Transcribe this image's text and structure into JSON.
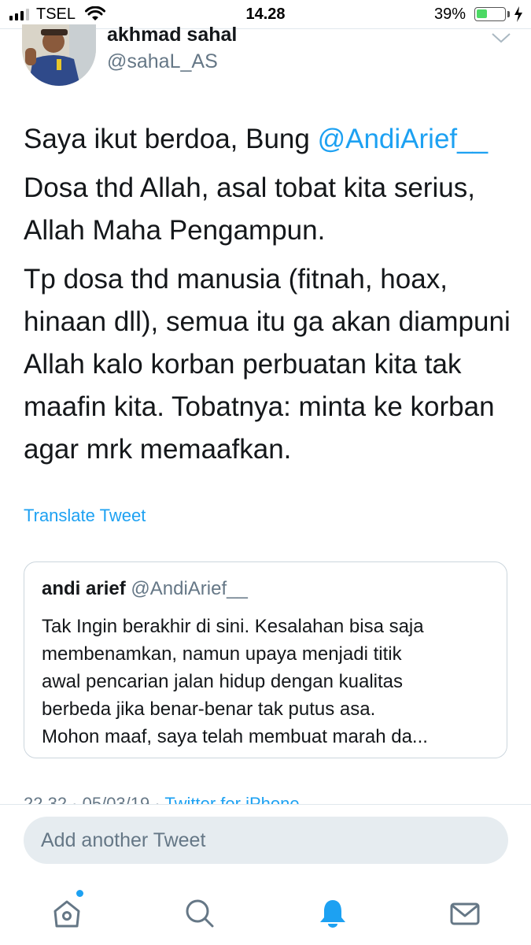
{
  "status_bar": {
    "carrier": "TSEL",
    "time": "14.28",
    "battery_percent": "39%",
    "battery_level": 0.39,
    "signal_strength": 3,
    "icons": [
      "signal-icon",
      "wifi-icon",
      "battery-icon",
      "charging-bolt-icon"
    ]
  },
  "tweet": {
    "author_name": "akhmad sahal",
    "author_handle": "@sahaL_AS",
    "body": {
      "line1_text": "Saya ikut berdoa, Bung ",
      "line1_mention": "@AndiArief__",
      "para2": "Dosa thd Allah, asal tobat kita serius, Allah Maha Pengampun.",
      "para3": "Tp dosa thd manusia (fitnah, hoax, hinaan dll), semua itu ga akan diampuni Allah kalo korban perbuatan kita tak maafin kita. Tobatnya: minta ke korban agar mrk memaafkan."
    },
    "translate_label": "Translate Tweet",
    "meta_time_date": "22.32 · 05/03/19 · ",
    "meta_via": "Twitter for iPhone"
  },
  "quote": {
    "name": "andi arief",
    "handle": "@AndiArief__",
    "lines": [
      "Tak Ingin berakhir di sini. Kesalahan bisa saja",
      "membenamkan, namun upaya menjadi titik",
      "awal  pencarian jalan hidup dengan kualitas",
      "berbeda jika benar-benar tak putus asa.",
      "Mohon maaf, saya telah membuat marah da..."
    ]
  },
  "composer": {
    "placeholder": "Add another Tweet"
  },
  "tab_bar": {
    "tabs": [
      "home-icon",
      "search-icon",
      "notifications-icon",
      "messages-icon"
    ],
    "active_tab": "notifications-icon",
    "accent_color": "#1da1f2",
    "inactive_color": "#657786"
  },
  "colors": {
    "link": "#1da1f2",
    "text": "#14171a",
    "secondary": "#657786",
    "battery_green": "#4cd964"
  }
}
